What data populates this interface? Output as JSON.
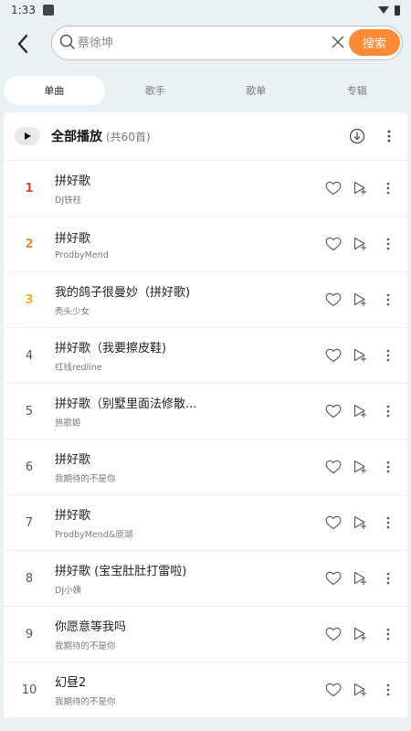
{
  "status": {
    "time": "1:33"
  },
  "search": {
    "value": "",
    "placeholder": "蔡徐坤",
    "button_label": "搜索"
  },
  "tabs": [
    {
      "label": "单曲",
      "active": true
    },
    {
      "label": "歌手",
      "active": false
    },
    {
      "label": "歌单",
      "active": false
    },
    {
      "label": "专辑",
      "active": false
    }
  ],
  "play_all": {
    "label": "全部播放",
    "count": "(共60首)"
  },
  "songs": [
    {
      "rank": "1",
      "title": "拼好歌",
      "artist": "DJ铁柱"
    },
    {
      "rank": "2",
      "title": "拼好歌",
      "artist": "ProdbyMend"
    },
    {
      "rank": "3",
      "title": "我的鸽子很曼妙（拼好歌)",
      "artist": "秃头少女"
    },
    {
      "rank": "4",
      "title": "拼好歌（我要擦皮鞋)",
      "artist": "红线redline"
    },
    {
      "rank": "5",
      "title": "拼好歌（别墅里面法修散...",
      "artist": "热歌姬"
    },
    {
      "rank": "6",
      "title": "拼好歌",
      "artist": "我期待的不是你"
    },
    {
      "rank": "7",
      "title": "拼好歌",
      "artist": "ProdbyMend&原湖"
    },
    {
      "rank": "8",
      "title": "拼好歌 (宝宝肚肚打雷啦)",
      "artist": "DJ小姨"
    },
    {
      "rank": "9",
      "title": "你愿意等我吗",
      "artist": "我期待的不是你"
    },
    {
      "rank": "10",
      "title": "幻昼2",
      "artist": "我期待的不是你"
    }
  ],
  "colors": {
    "accent": "#ff8a36",
    "rank1": "#e8413c",
    "rank2": "#f08c1e",
    "rank3": "#f2b12a",
    "background": "#e9f1f5"
  }
}
